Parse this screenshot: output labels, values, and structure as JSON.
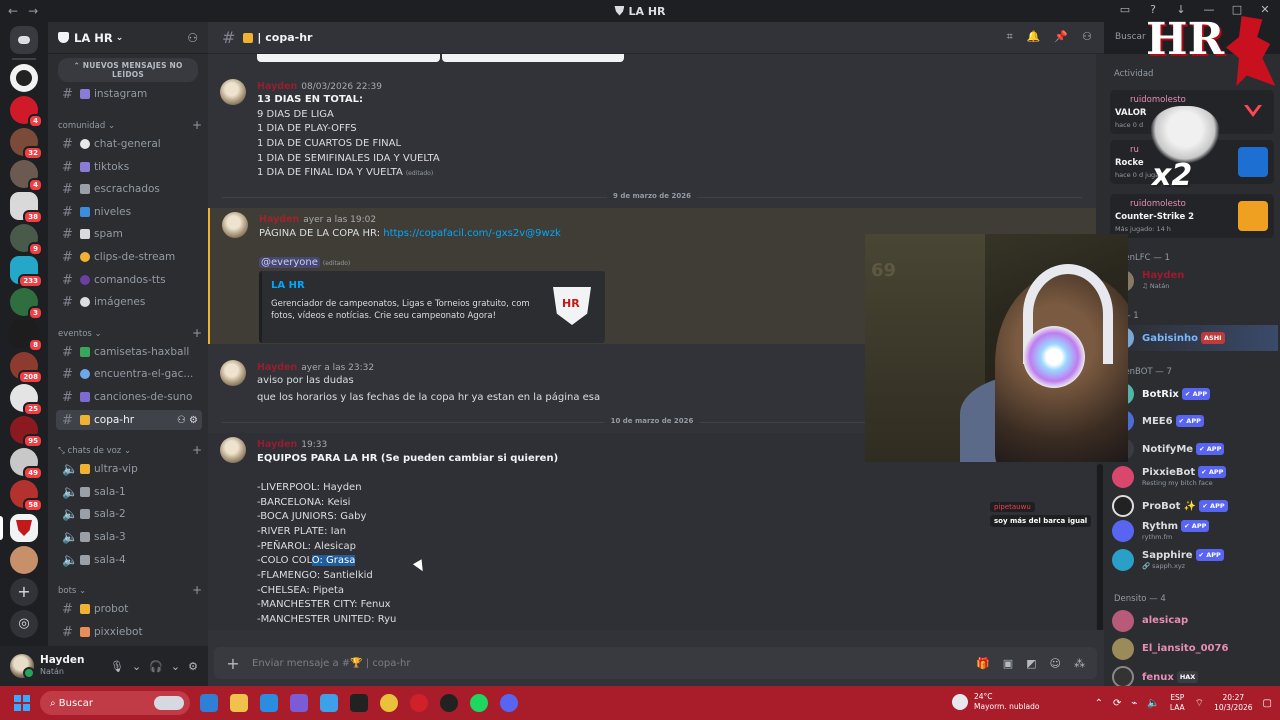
{
  "window": {
    "title": "LA HR"
  },
  "server": {
    "name": "LA HR"
  },
  "rail": {
    "badges": [
      "",
      "",
      "4",
      "32",
      "4",
      "38",
      "9",
      "233",
      "3",
      "8",
      "208",
      "25",
      "95",
      "49",
      "58",
      "",
      ""
    ]
  },
  "sidebar": {
    "new_messages_pill": "NUEVOS MENSAJES NO LEÍDOS",
    "channels_top": [
      {
        "label": "instagram"
      }
    ],
    "categories": {
      "comunidad": "comunidad",
      "eventos": "eventos",
      "voz": "chats de voz",
      "bots": "bots"
    },
    "comunidad": [
      "chat-general",
      "tiktoks",
      "escrachados",
      "niveles",
      "spam",
      "clips-de-stream",
      "comandos-tts",
      "imágenes"
    ],
    "eventos": [
      "camisetas-haxball",
      "encuentra-el-gac...",
      "canciones-de-suno",
      "copa-hr"
    ],
    "voz": [
      "ultra-vip",
      "sala-1",
      "sala-2",
      "sala-3",
      "sala-4"
    ],
    "bots": [
      "probot",
      "pixxiebot"
    ]
  },
  "user": {
    "name": "Hayden",
    "status": "Natán"
  },
  "chat": {
    "channel_name": "| copa-hr",
    "composer_placeholder": "Enviar mensaje a #🏆 | copa-hr",
    "search_placeholder": "Buscar"
  },
  "messages": {
    "m1": {
      "author": "Hayden",
      "time": "08/03/2026 22:39",
      "lines": [
        "13 DIAS EN TOTAL:",
        "9 DIAS DE LIGA",
        "1 DIA DE PLAY-OFFS",
        "1 DIA DE CUARTOS DE FINAL",
        "1 DIA DE SEMIFINALES IDA Y VUELTA",
        "1 DIA DE FINAL IDA Y VUELTA"
      ],
      "edited": "(editado)"
    },
    "divider1": "9 de marzo de 2026",
    "m2": {
      "author": "Hayden",
      "time": "ayer a las 19:02",
      "text_prefix": "PÁGINA DE LA COPA HR: ",
      "link": "https://copafacil.com/-gxs2v@9wzk",
      "mention": "@everyone",
      "edited": "(editado)",
      "embed_title": "LA HR",
      "embed_desc": "Gerenciador de campeonatos, Ligas e Torneios gratuito, com fotos, vídeos e notícias. Crie seu campeonato Agora!"
    },
    "m3": {
      "author": "Hayden",
      "time": "ayer a las 23:32",
      "lines": [
        "aviso por las dudas",
        "que los horarios y las fechas de la copa hr ya estan en la página esa"
      ]
    },
    "divider2": "10 de marzo de 2026",
    "m4": {
      "author": "Hayden",
      "time": "19:33",
      "title": "EQUIPOS PARA LA HR (Se pueden cambiar si quieren)",
      "teams": [
        "-LIVERPOOL: Hayden",
        "-BARCELONA: Keisi",
        "-BOCA JUNIORS: Gaby",
        "-RIVER PLATE: Ian",
        "-PEÑAROL: Alesicap"
      ],
      "colo_a": "-COLO COL",
      "colo_b": "O: Grasa",
      "teams2": [
        "-FLAMENGO: Santielkid",
        "-CHELSEA: Pipeta",
        "-MANCHESTER CITY: Fenux",
        "-MANCHESTER UNITED: Ryu"
      ]
    }
  },
  "members": {
    "activity_header": "Actividad",
    "activities": [
      {
        "user": "ruidomolesto",
        "game": "VALOR",
        "sub": "hace 0 d"
      },
      {
        "user": "ru",
        "game": "Rocke",
        "sub": "hace 0 d   jugador"
      },
      {
        "user": "ruidomolesto",
        "game": "Counter-Strike 2",
        "sub": "Más jugado: 14 h"
      }
    ],
    "group1": "ydenLFC — 1",
    "group2": "d — 1",
    "group3": "ydenBOT — 7",
    "group4": "Densito — 4",
    "list": [
      {
        "name": "Hayden",
        "status": "♫ Natán",
        "color": "#e8102a"
      },
      {
        "name": "Gabisinho",
        "status": "",
        "color": "#79b7ff",
        "tag": "ASHI"
      },
      {
        "name": "BotRix",
        "status": "",
        "color": "#f2f3f5",
        "tag": "✔ APP"
      },
      {
        "name": "MEE6",
        "status": "",
        "color": "#f2f3f5",
        "tag": "✔ APP"
      },
      {
        "name": "NotifyMe",
        "status": "",
        "color": "#f2f3f5",
        "tag": "✔ APP"
      },
      {
        "name": "PixxieBot",
        "status": "Resting my bitch face",
        "color": "#f2f3f5",
        "tag": "✔ APP"
      },
      {
        "name": "ProBot ✨",
        "status": "",
        "color": "#f2f3f5",
        "tag": "✔ APP"
      },
      {
        "name": "Rythm",
        "status": "rythm.fm",
        "color": "#f2f3f5",
        "tag": "✔ APP"
      },
      {
        "name": "Sapphire",
        "status": "🔗 sapph.xyz",
        "color": "#f2f3f5",
        "tag": "✔ APP"
      },
      {
        "name": "alesicap",
        "status": "",
        "color": "#e88eb4"
      },
      {
        "name": "El_iansito_0076",
        "status": "",
        "color": "#e88eb4"
      },
      {
        "name": "fenux",
        "status": "",
        "color": "#e88eb4",
        "tag": "HAX"
      }
    ]
  },
  "overlay": {
    "logo_text": "HR",
    "sticker_text": "x2",
    "chat_user": "pipetauwu",
    "chat_text": "soy más del barca igual",
    "cam_poster": "69"
  },
  "taskbar": {
    "search": "Buscar",
    "temp": "24°C",
    "weather": "Mayorm. nublado",
    "lang1": "ESP",
    "lang2": "LAA",
    "time": "20:27",
    "date": "10/3/2026"
  }
}
